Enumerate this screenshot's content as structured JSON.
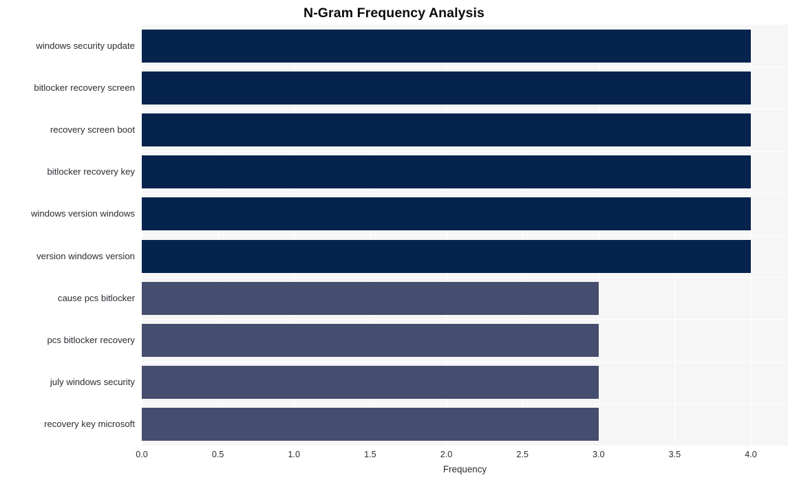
{
  "chart_data": {
    "type": "bar",
    "orientation": "horizontal",
    "title": "N-Gram Frequency Analysis",
    "xlabel": "Frequency",
    "ylabel": "",
    "categories": [
      "windows security update",
      "bitlocker recovery screen",
      "recovery screen boot",
      "bitlocker recovery key",
      "windows version windows",
      "version windows version",
      "cause pcs bitlocker",
      "pcs bitlocker recovery",
      "july windows security",
      "recovery key microsoft"
    ],
    "values": [
      4,
      4,
      4,
      4,
      4,
      4,
      3,
      3,
      3,
      3
    ],
    "bar_colors": [
      "#05234d",
      "#05234d",
      "#05234d",
      "#05234d",
      "#05234d",
      "#05234d",
      "#454e6e",
      "#454e6e",
      "#454e6e",
      "#454e6e"
    ],
    "xlim": [
      0,
      4
    ],
    "xticks": [
      0,
      0.5,
      1,
      1.5,
      2,
      2.5,
      3,
      3.5,
      4
    ],
    "xtick_labels": [
      "0.0",
      "0.5",
      "1.0",
      "1.5",
      "2.0",
      "2.5",
      "3.0",
      "3.5",
      "4.0"
    ],
    "grid": true,
    "grid_color": "#ffffff",
    "plot_background": "#f6f6f7",
    "figure_background": "#ffffff",
    "legend": null,
    "legend_position": "none"
  },
  "style": {
    "title_color": "#0a0a0a",
    "tick_color": "#2b2b33",
    "accent_dark": "#05234d",
    "accent_light": "#454e6e"
  }
}
